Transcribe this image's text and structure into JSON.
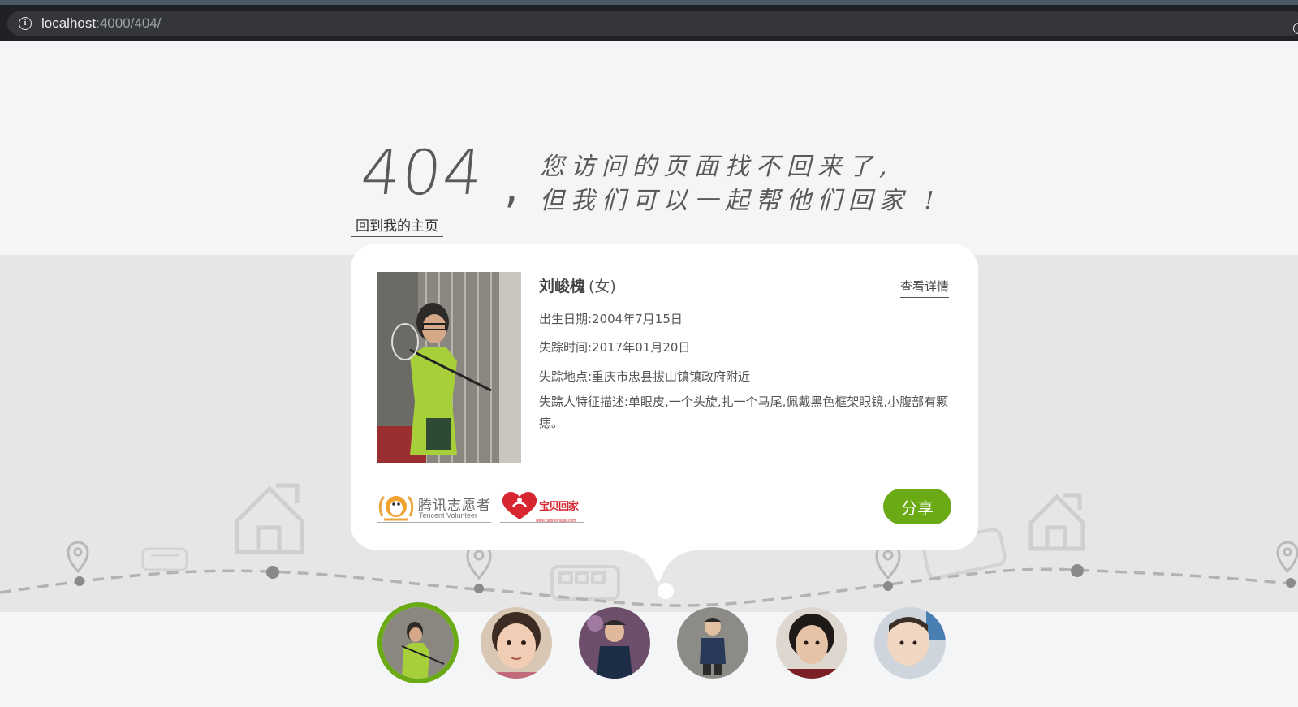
{
  "browser": {
    "url_host": "localhost",
    "url_path": ":4000/404/"
  },
  "headline": {
    "code": "404",
    "comma": ",",
    "line1": "您访问的页面找不回来了,",
    "line2": "但我们可以一起帮他们回家 !"
  },
  "home_link": "回到我的主页",
  "card": {
    "name": "刘峻槐",
    "gender": "(女)",
    "detail_link": "查看详情",
    "birth": "出生日期:2004年7月15日",
    "missing_time": "失踪时间:2017年01月20日",
    "missing_place": "失踪地点:重庆市忠县拔山镇镇政府附近",
    "description": "失踪人特征描述:单眼皮,一个头旋,扎一个马尾,佩戴黑色框架眼镜,小腹部有颗痣。",
    "share_label": "分享",
    "logos": {
      "tencent_cn": "腾讯志愿者",
      "tencent_en": "Tencent Volunteer",
      "baobei_cn": "宝贝回家",
      "baobei_url": "www.baobeihuijia.com"
    }
  },
  "avatars": [
    {
      "name": "avatar-1",
      "active": true
    },
    {
      "name": "avatar-2",
      "active": false
    },
    {
      "name": "avatar-3",
      "active": false
    },
    {
      "name": "avatar-4",
      "active": false
    },
    {
      "name": "avatar-5",
      "active": false
    },
    {
      "name": "avatar-6",
      "active": false
    }
  ],
  "colors": {
    "accent_green": "#6aaa14",
    "band_gray": "#e6e6e6",
    "brand_red": "#d7262f",
    "chrome_dark": "#202124"
  }
}
